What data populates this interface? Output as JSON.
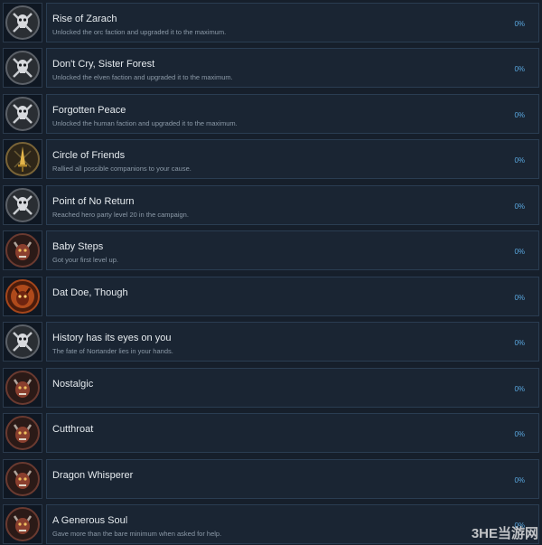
{
  "achievements": [
    {
      "title": "Rise of Zarach",
      "description": "Unlocked the orc faction and upgraded it to the maximum.",
      "percent": "0%",
      "icon": "skull-crossed-swords-icon"
    },
    {
      "title": "Don't Cry, Sister Forest",
      "description": "Unlocked the elven faction and upgraded it to the maximum.",
      "percent": "0%",
      "icon": "skull-crossed-swords-icon"
    },
    {
      "title": "Forgotten Peace",
      "description": "Unlocked the human faction and upgraded it to the maximum.",
      "percent": "0%",
      "icon": "skull-crossed-swords-icon"
    },
    {
      "title": "Circle of Friends",
      "description": "Rallied all possible companions to your cause.",
      "percent": "0%",
      "icon": "golden-sword-icon"
    },
    {
      "title": "Point of No Return",
      "description": "Reached hero party level 20 in the campaign.",
      "percent": "0%",
      "icon": "skull-crossed-swords-icon"
    },
    {
      "title": "Baby Steps",
      "description": "Got your first level up.",
      "percent": "0%",
      "icon": "demon-head-icon"
    },
    {
      "title": "Dat Doe, Though",
      "description": "",
      "percent": "0%",
      "icon": "fire-demon-icon"
    },
    {
      "title": "History has its eyes on you",
      "description": "The fate of Nortander lies in your hands.",
      "percent": "0%",
      "icon": "skull-crossed-swords-icon"
    },
    {
      "title": "Nostalgic",
      "description": "",
      "percent": "0%",
      "icon": "demon-head-icon"
    },
    {
      "title": "Cutthroat",
      "description": "",
      "percent": "0%",
      "icon": "demon-head-icon"
    },
    {
      "title": "Dragon Whisperer",
      "description": "",
      "percent": "0%",
      "icon": "demon-head-icon"
    },
    {
      "title": "A Generous Soul",
      "description": "Gave more than the bare minimum when asked for help.",
      "percent": "0%",
      "icon": "demon-head-icon"
    }
  ],
  "watermark": {
    "text": "3HE当游网"
  },
  "colors": {
    "background": "#161f2b",
    "card": "#1a2533",
    "card_border": "#2a3d52",
    "title": "#e6ebef",
    "description": "#8c9aa8",
    "percent": "#5aa8e0"
  }
}
